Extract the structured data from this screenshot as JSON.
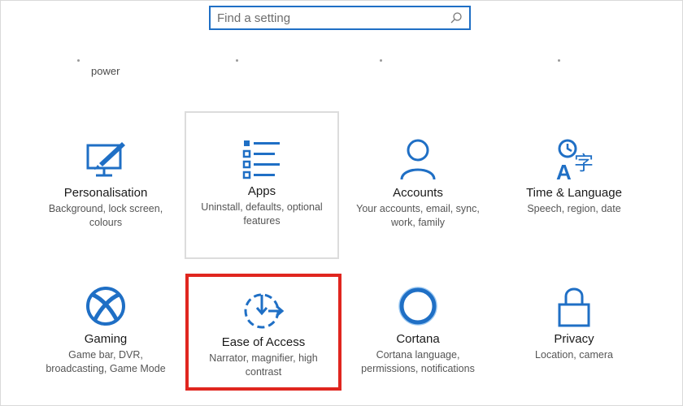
{
  "search": {
    "placeholder": "Find a setting"
  },
  "top_row_partial": {
    "label": "power"
  },
  "tiles": [
    {
      "title": "Personalisation",
      "desc": "Background, lock screen, colours",
      "icon": "personalisation-icon"
    },
    {
      "title": "Apps",
      "desc": "Uninstall, defaults, optional features",
      "icon": "apps-icon"
    },
    {
      "title": "Accounts",
      "desc": "Your accounts, email, sync, work, family",
      "icon": "accounts-icon"
    },
    {
      "title": "Time & Language",
      "desc": "Speech, region, date",
      "icon": "time-language-icon"
    },
    {
      "title": "Gaming",
      "desc": "Game bar, DVR, broadcasting, Game Mode",
      "icon": "xbox-icon"
    },
    {
      "title": "Ease of Access",
      "desc": "Narrator, magnifier, high contrast",
      "icon": "ease-of-access-icon"
    },
    {
      "title": "Cortana",
      "desc": "Cortana language, permissions, notifications",
      "icon": "cortana-icon"
    },
    {
      "title": "Privacy",
      "desc": "Location, camera",
      "icon": "lock-icon"
    }
  ],
  "colors": {
    "accent": "#1f6fc5",
    "highlight": "#e0261f"
  }
}
